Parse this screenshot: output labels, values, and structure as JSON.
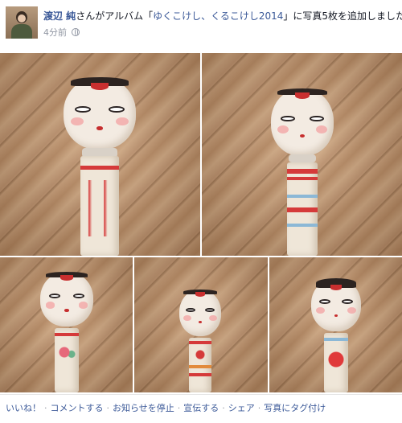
{
  "post": {
    "author": "渡辺 純",
    "story_text_1": "さんがアルバム「",
    "album_name": "ゆくこけし、くるこけし2014",
    "story_text_2": "」に写真5枚を追加しました。",
    "timestamp": "4分前"
  },
  "photos": [
    {
      "alt": "kokeshi-doll-photo-1"
    },
    {
      "alt": "kokeshi-doll-photo-2"
    },
    {
      "alt": "kokeshi-doll-photo-3"
    },
    {
      "alt": "kokeshi-doll-photo-4"
    },
    {
      "alt": "kokeshi-doll-photo-5"
    }
  ],
  "actions": {
    "like": "いいね！",
    "comment": "コメントする",
    "stop_notifications": "お知らせを停止",
    "promote": "宣伝する",
    "share": "シェア",
    "tag_photo": "写真にタグ付け",
    "separator": "·"
  },
  "colors": {
    "link": "#3b5998",
    "meta": "#9197a3",
    "text": "#141823"
  }
}
